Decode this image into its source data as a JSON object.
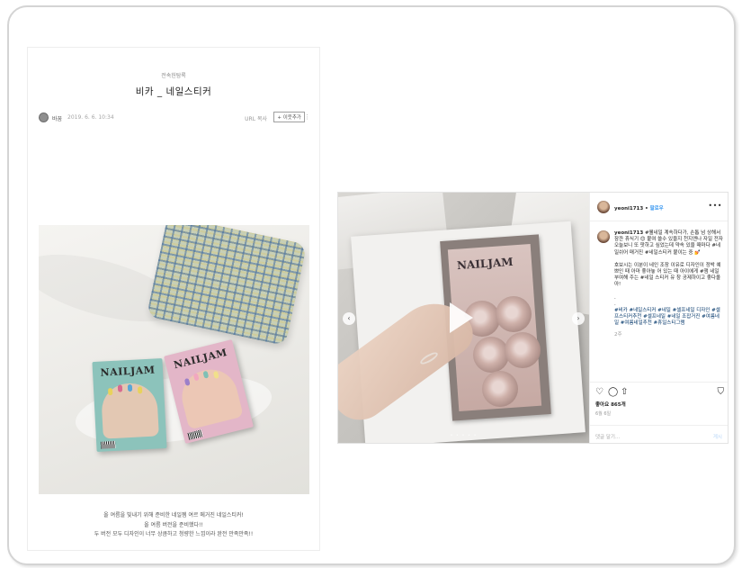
{
  "blog": {
    "category": "전속헌탐록",
    "title": "비카 _ 네일스티커",
    "author": "바꿈",
    "date": "2019. 6. 6. 10:34",
    "url_copy": "URL 복사",
    "neighbor_button": "+ 이웃추가",
    "more": "⋮",
    "photo_brand_left": "NAILJAM",
    "photo_brand_right": "NAILJAM",
    "caption_lines": [
      "올 여름을 빛내기 위해 준비한 네일젬 여르 메거진 네일스티커!",
      "올 여름 버전을 준비했다!!",
      "두 버전 모두 디자인이 너무 상큼하고 청량한 느낌이라 완전 만족만족!!"
    ]
  },
  "instagram": {
    "username": "yeoni1713",
    "separator": " • ",
    "follow_label": "팔로우",
    "more": "•••",
    "post_brand": "NAILJAM",
    "nav_left": "‹",
    "nav_right": "›",
    "carousel_dots": "• • • • •",
    "caption_user": "yeoni1713",
    "caption_line1": " #웰네일 계속하다가, 손톱 넘 상해서 잠깐 휴식기 😊 붙여 쓸수 있을지 천지엔나 자일 전자 오늘보니 또 팟하고 싶었는데 약속 있을 때마다 #네일쉬어 매거진 #네일스티커 붙이는 중 💅",
    "caption_line2": "호보시는 이분이 네인 조장 이유로 디자인이 정박 예쁘인 때 아마 좋아놓 어 있는 때 아이에게 #잼 네일 부여해 주는 #네일 스티커 유 창 공제하이고 좋다올 아!",
    "caption_dot1": ".",
    "caption_dot2": ".",
    "caption_tags": "#비카 #네일스티커 #네일 #셀프네일 디자인 #셀프스티커추천 #셀프네일 #네일 조잡거진 #여름네일 #여름네일추천 #휴일스티그램",
    "caption_time": "2주",
    "heart_icon": "♡",
    "comment_icon": "◯",
    "share_icon": "⇧",
    "bookmark_icon": "⛉",
    "likes": "좋아요 865개",
    "post_date": "6월 6일",
    "comment_placeholder": "댓글 달기...",
    "post_button": "게시"
  },
  "colors": {
    "link_blue": "#3897f0",
    "frame_border": "#d4d4d4"
  }
}
